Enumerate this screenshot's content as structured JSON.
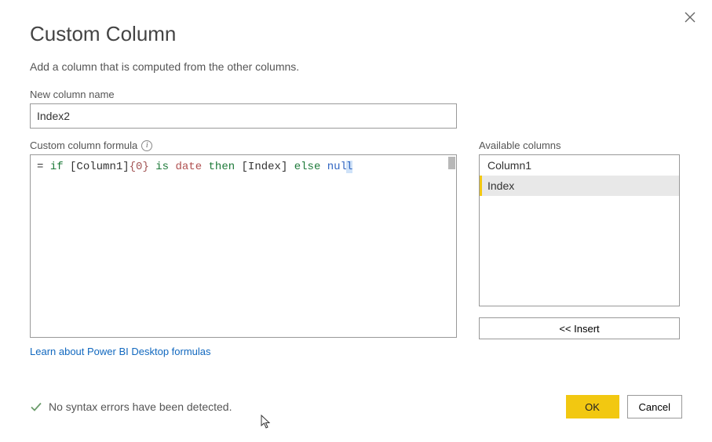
{
  "dialog": {
    "title": "Custom Column",
    "subtitle": "Add a column that is computed from the other columns."
  },
  "nameField": {
    "label": "New column name",
    "value": "Index2"
  },
  "formula": {
    "label": "Custom column formula",
    "prefix": "= ",
    "tokens": {
      "if": "if",
      "col1": "[Column1]",
      "idx0": "{0}",
      "is": "is",
      "date": "date",
      "then": "then",
      "index": "[Index]",
      "else": "else",
      "nul": "nul",
      "l": "l"
    }
  },
  "available": {
    "label": "Available columns",
    "items": [
      "Column1",
      "Index"
    ],
    "selectedIndex": 1,
    "insertLabel": "<< Insert"
  },
  "link": "Learn about Power BI Desktop formulas",
  "status": "No syntax errors have been detected.",
  "buttons": {
    "ok": "OK",
    "cancel": "Cancel"
  }
}
